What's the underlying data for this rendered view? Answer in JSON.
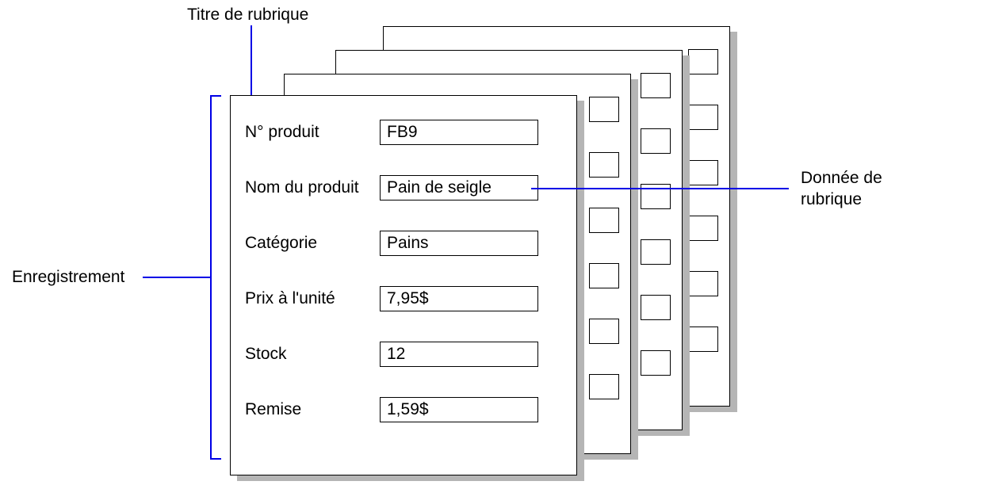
{
  "callouts": {
    "field_title": "Titre de rubrique",
    "record": "Enregistrement",
    "field_data_line1": "Donnée de",
    "field_data_line2": "rubrique"
  },
  "fields": [
    {
      "label": "N° produit",
      "value": "FB9"
    },
    {
      "label": "Nom du produit",
      "value": "Pain de seigle"
    },
    {
      "label": "Catégorie",
      "value": "Pains"
    },
    {
      "label": "Prix à l'unité",
      "value": "7,95$"
    },
    {
      "label": "Stock",
      "value": "12"
    },
    {
      "label": "Remise",
      "value": "1,59$"
    }
  ]
}
